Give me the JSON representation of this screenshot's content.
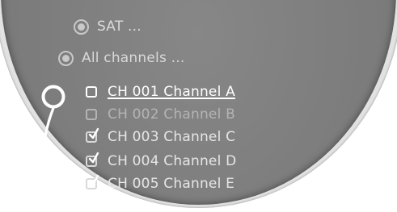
{
  "menu": {
    "sat_label": "SAT ...",
    "all_channels_label": "All channels ...",
    "channels": [
      {
        "label": "CH 001 Channel A",
        "checked": false
      },
      {
        "label": "CH 002 Channel B",
        "checked": false
      },
      {
        "label": "CH 003 Channel C",
        "checked": true
      },
      {
        "label": "CH 004 Channel D",
        "checked": true
      },
      {
        "label": "CH 005 Channel E",
        "checked": true
      }
    ]
  },
  "colors": {
    "panel": "#7d7d7d",
    "text": "#d9d9d9",
    "highlight": "#ffffff"
  },
  "icons": {
    "sat": "radio-icon",
    "all_channels": "radio-icon",
    "unchecked": "checkbox-empty-icon",
    "checked": "checkbox-checked-icon",
    "controller": "controller-knob-icon"
  }
}
